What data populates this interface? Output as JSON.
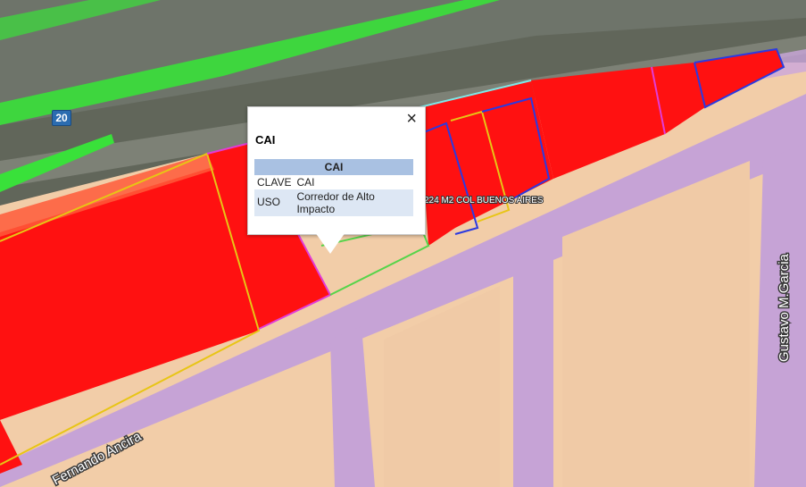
{
  "map": {
    "shield_number": "20",
    "street_labels": {
      "fernando_ancira": "Fernando Ancira",
      "gustavo_m_garcia": "Gustavo M.Garcia"
    },
    "parcel_label": "224 M2 COL BUENOS AIRES",
    "colors": {
      "residential": "#f2cda8",
      "commercial_red": "#ff1111",
      "street_purple": "#c6a3d6",
      "highway": "#5c6157",
      "green_strip": "#39e13a"
    }
  },
  "popup": {
    "close_icon": "×",
    "title": "CAI",
    "table": {
      "header": "CAI",
      "rows": [
        {
          "key": "CLAVE",
          "value": "CAI"
        },
        {
          "key": "USO",
          "value": "Corredor de Alto Impacto"
        }
      ]
    }
  }
}
